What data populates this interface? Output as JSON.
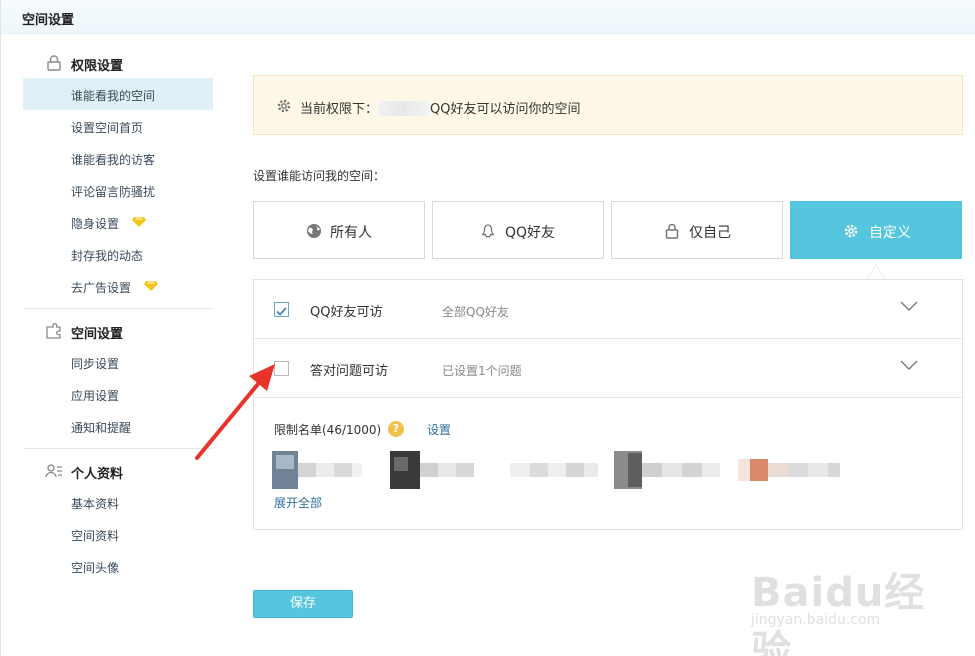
{
  "topbar": {
    "title": "空间设置"
  },
  "sidebar": {
    "sections": [
      {
        "label": "权限设置",
        "icon": "lock-icon",
        "items": [
          "谁能看我的空间",
          "设置空间首页",
          "谁能看我的访客",
          "评论留言防骚扰",
          "隐身设置",
          "封存我的动态",
          "去广告设置"
        ]
      },
      {
        "label": "空间设置",
        "icon": "puzzle-icon",
        "items": [
          "同步设置",
          "应用设置",
          "通知和提醒"
        ]
      },
      {
        "label": "个人资料",
        "icon": "profile-icon",
        "items": [
          "基本资料",
          "空间资料",
          "空间头像"
        ]
      }
    ],
    "active_item": "谁能看我的空间",
    "vip_items": [
      "隐身设置",
      "去广告设置"
    ]
  },
  "notice": {
    "prefix": "当前权限下：",
    "suffix": "QQ好友可以访问你的空间"
  },
  "access": {
    "label": "设置谁能访问我的空间：",
    "options": [
      {
        "label": "所有人",
        "icon": "globe-icon"
      },
      {
        "label": "QQ好友",
        "icon": "friends-icon"
      },
      {
        "label": "仅自己",
        "icon": "lock-icon"
      },
      {
        "label": "自定义",
        "icon": "gear-icon"
      }
    ],
    "selected": "自定义"
  },
  "custom": {
    "rows": [
      {
        "name": "QQ好友可访",
        "desc": "全部QQ好友",
        "checked": true
      },
      {
        "name": "答对问题可访",
        "desc": "已设置1个问题",
        "checked": false
      }
    ],
    "limit_label": "限制名单(46/1000)",
    "help": "?",
    "set_link": "设置",
    "expand_link": "展开全部"
  },
  "save_label": "保存",
  "watermark": {
    "logo": "Baidu经验",
    "url": "jingyan.baidu.com"
  },
  "colors": {
    "accent": "#55c6de",
    "notice_bg": "#fdf8e8",
    "annotation_arrow": "#e8332a",
    "vip_gem": "#f5c518"
  }
}
